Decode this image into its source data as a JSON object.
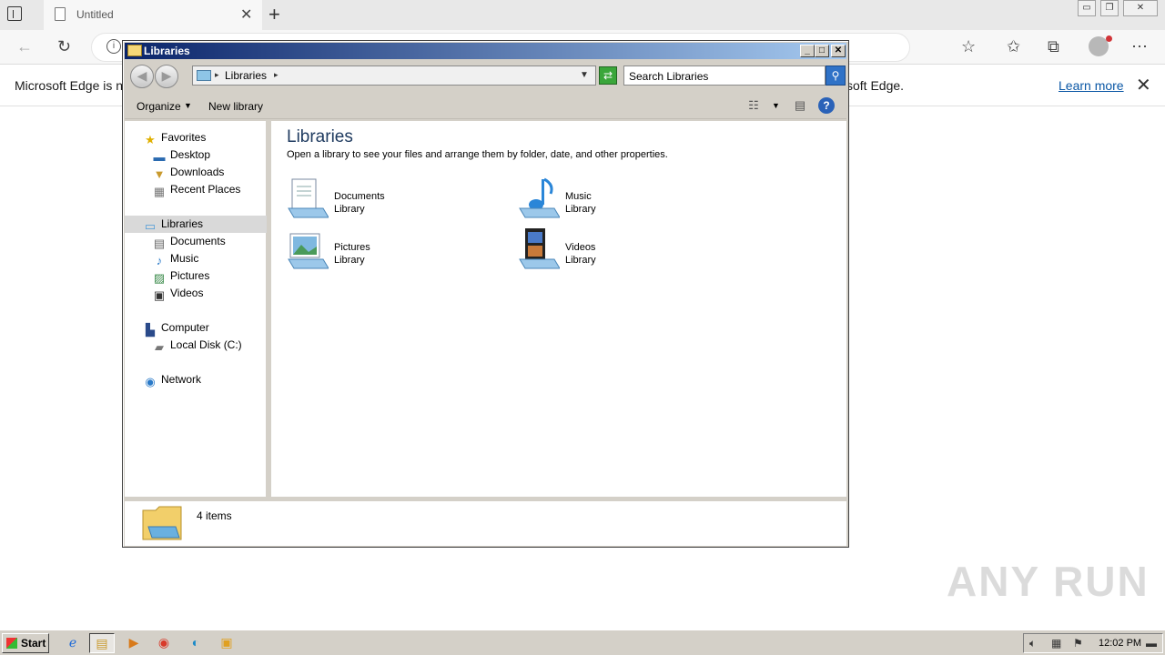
{
  "edge": {
    "tab_title": "Untitled",
    "infobar_left": "Microsoft Edge is no",
    "infobar_right": "soft Edge.",
    "learn_more": "Learn more"
  },
  "explorer": {
    "window_title": "Libraries",
    "breadcrumb": "Libraries",
    "search_placeholder": "Search Libraries",
    "commands": {
      "organize": "Organize",
      "new_library": "New library"
    },
    "nav": {
      "favorites": "Favorites",
      "desktop": "Desktop",
      "downloads": "Downloads",
      "recent_places": "Recent Places",
      "libraries": "Libraries",
      "documents": "Documents",
      "music": "Music",
      "pictures": "Pictures",
      "videos": "Videos",
      "computer": "Computer",
      "local_disk": "Local Disk (C:)",
      "network": "Network"
    },
    "content": {
      "title": "Libraries",
      "description": "Open a library to see your files and arrange them by folder, date, and other properties.",
      "libraries": [
        {
          "name": "Documents",
          "sub": "Library",
          "icon": "documents-library-icon"
        },
        {
          "name": "Music",
          "sub": "Library",
          "icon": "music-library-icon"
        },
        {
          "name": "Pictures",
          "sub": "Library",
          "icon": "pictures-library-icon"
        },
        {
          "name": "Videos",
          "sub": "Library",
          "icon": "videos-library-icon"
        }
      ]
    },
    "details": {
      "count": "4 items"
    }
  },
  "watermark": "ANY RUN",
  "taskbar": {
    "start": "Start",
    "clock": "12:02 PM"
  },
  "colors": {
    "titlebar_start": "#0a246a",
    "titlebar_end": "#a6caf0",
    "link": "#0a57a5",
    "content_title": "#1e3a5f"
  }
}
